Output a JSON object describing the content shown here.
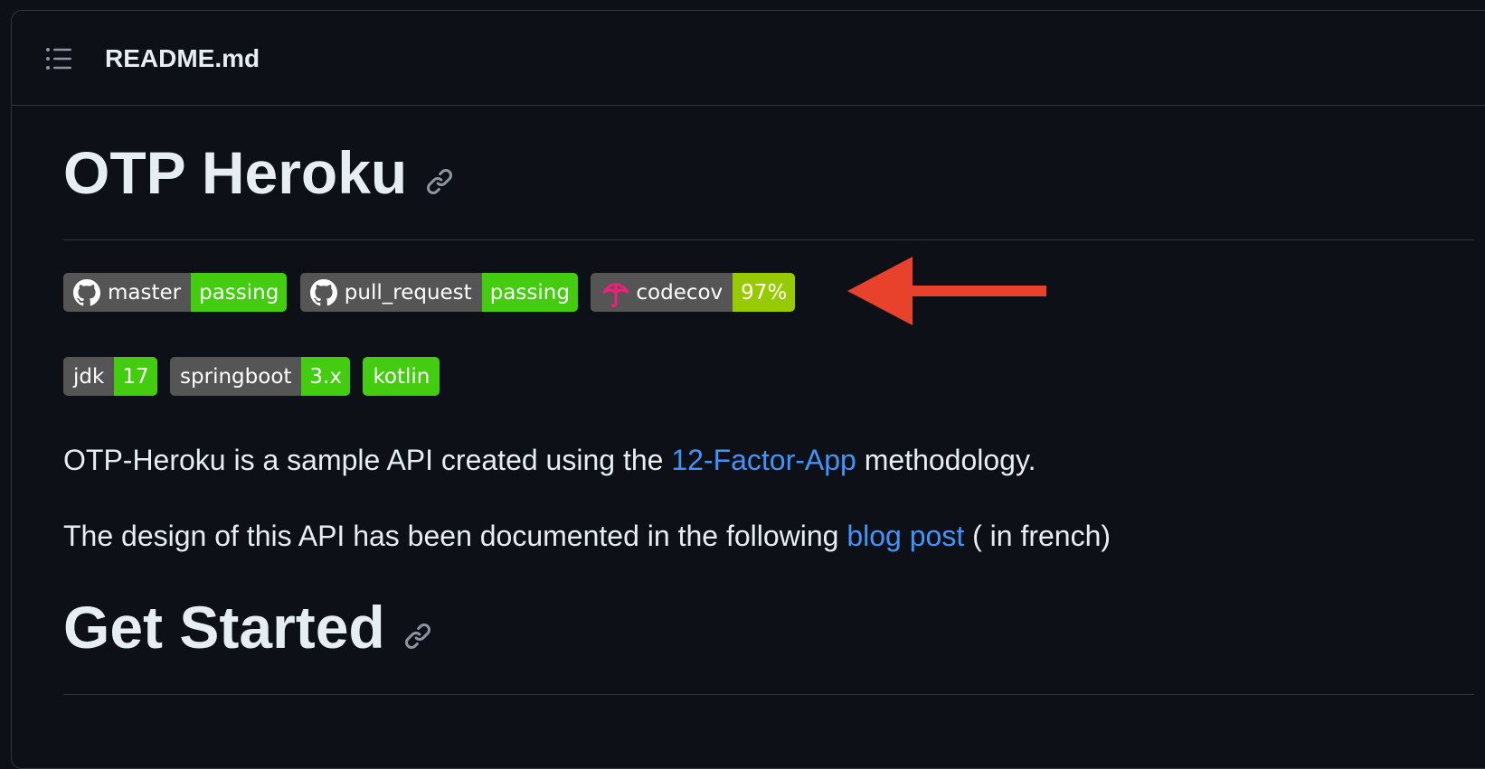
{
  "header": {
    "file_name": "README.md",
    "toc_icon": "list-unordered-icon"
  },
  "readme": {
    "title": "OTP Heroku",
    "badges_row1": [
      {
        "icon": "github-icon",
        "label": "master",
        "value": "passing",
        "color": "#4c1"
      },
      {
        "icon": "github-icon",
        "label": "pull_request",
        "value": "passing",
        "color": "#4c1"
      },
      {
        "icon": "codecov-umbrella-icon",
        "label": "codecov",
        "value": "97%",
        "color": "#97ca00"
      }
    ],
    "badges_row2": [
      {
        "label": "jdk",
        "value": "17",
        "color": "#4c1"
      },
      {
        "label": "springboot",
        "value": "3.x",
        "color": "#4c1"
      },
      {
        "label": "",
        "value": "kotlin",
        "color": "#4c1"
      }
    ],
    "para1": {
      "before": "OTP-Heroku is a sample API created using the ",
      "link": "12-Factor-App",
      "after": " methodology."
    },
    "para2": {
      "before": "The design of this API has been documented in the following ",
      "link": "blog post",
      "after": " ( in french)"
    },
    "heading2": "Get Started"
  },
  "annotation": {
    "arrow_color": "#e8412c",
    "arrow_icon": "red-arrow-left-icon"
  }
}
